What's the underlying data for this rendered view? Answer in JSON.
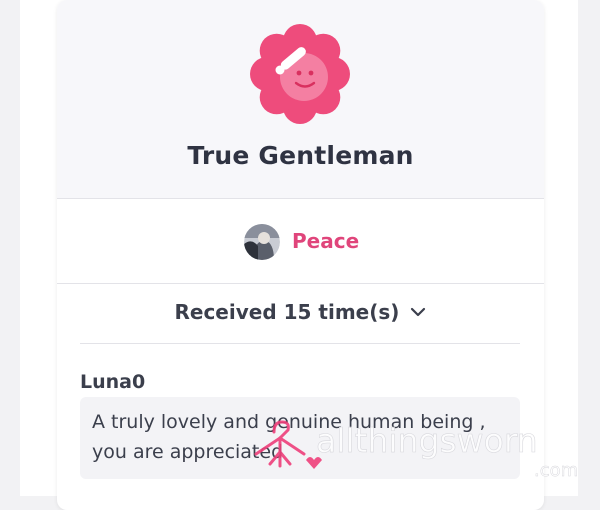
{
  "badge": {
    "title": "True Gentleman",
    "icon": "saluting-face-flower-icon",
    "color": "#ee4c7c"
  },
  "giver": {
    "name": "Peace",
    "name_color": "#e0457b"
  },
  "received": {
    "label": "Received 15 time(s)",
    "icon": "chevron-down-icon"
  },
  "comments": [
    {
      "author": "Luna0",
      "text": "A truly lovely and genuine human being , you are appreciated"
    }
  ],
  "watermark": {
    "text": "allthingsworn",
    "suffix": ".com"
  }
}
